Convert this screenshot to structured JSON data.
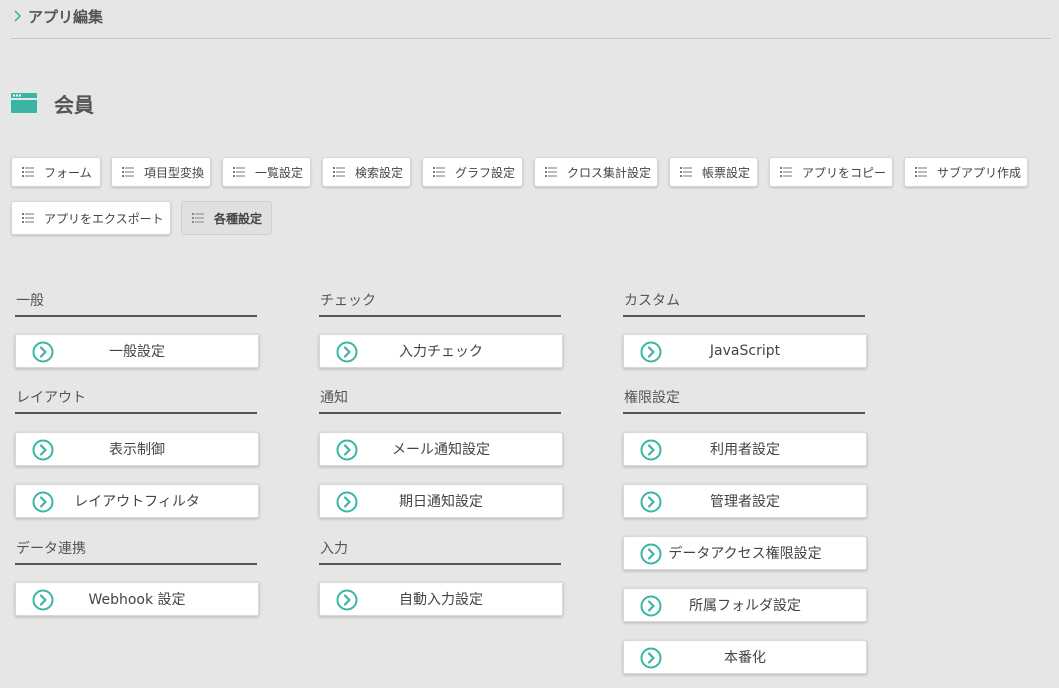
{
  "breadcrumb": {
    "label": "アプリ編集"
  },
  "app": {
    "title": "会員"
  },
  "toolbar": {
    "items": [
      {
        "label": "フォーム"
      },
      {
        "label": "項目型変換"
      },
      {
        "label": "一覧設定"
      },
      {
        "label": "検索設定"
      },
      {
        "label": "グラフ設定"
      },
      {
        "label": "クロス集計設定"
      },
      {
        "label": "帳票設定"
      },
      {
        "label": "アプリをコピー"
      },
      {
        "label": "サブアプリ作成"
      },
      {
        "label": "アプリをエクスポート"
      },
      {
        "label": "各種設定"
      }
    ]
  },
  "sections": {
    "general": {
      "title": "一般",
      "items": [
        {
          "label": "一般設定"
        }
      ]
    },
    "layout": {
      "title": "レイアウト",
      "items": [
        {
          "label": "表示制御"
        },
        {
          "label": "レイアウトフィルタ"
        }
      ]
    },
    "data_link": {
      "title": "データ連携",
      "items": [
        {
          "label": "Webhook 設定"
        }
      ]
    },
    "check": {
      "title": "チェック",
      "items": [
        {
          "label": "入力チェック"
        }
      ]
    },
    "notify": {
      "title": "通知",
      "items": [
        {
          "label": "メール通知設定"
        },
        {
          "label": "期日通知設定"
        }
      ]
    },
    "input": {
      "title": "入力",
      "items": [
        {
          "label": "自動入力設定"
        }
      ]
    },
    "custom": {
      "title": "カスタム",
      "items": [
        {
          "label": "JavaScript"
        }
      ]
    },
    "permission": {
      "title": "権限設定",
      "items": [
        {
          "label": "利用者設定"
        },
        {
          "label": "管理者設定"
        },
        {
          "label": "データアクセス権限設定"
        },
        {
          "label": "所属フォルダ設定"
        },
        {
          "label": "本番化"
        }
      ]
    }
  },
  "colors": {
    "accent": "#3bb5a3",
    "background": "#e6e6e6"
  },
  "icons": {
    "breadcrumb": "chevron-right-icon",
    "app": "app-window-icon",
    "toolbar": "list-icon",
    "settings": "circle-arrow-right-icon"
  }
}
